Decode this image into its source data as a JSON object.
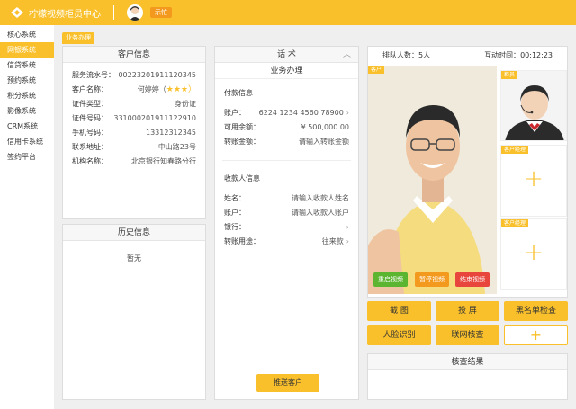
{
  "header": {
    "app_title": "柠檬视频柜员中心",
    "status": "示忙"
  },
  "sidebar": {
    "items": [
      {
        "label": "核心系统",
        "active": false
      },
      {
        "label": "网银系统",
        "active": true
      },
      {
        "label": "信贷系统",
        "active": false
      },
      {
        "label": "预约系统",
        "active": false
      },
      {
        "label": "积分系统",
        "active": false
      },
      {
        "label": "影像系统",
        "active": false
      },
      {
        "label": "CRM系统",
        "active": false
      },
      {
        "label": "信用卡系统",
        "active": false
      },
      {
        "label": "签约平台",
        "active": false
      }
    ]
  },
  "tab": {
    "label": "业务办理"
  },
  "customer": {
    "title": "客户信息",
    "rows": [
      {
        "k": "服务流水号：",
        "v": "00223201911120345"
      },
      {
        "k": "客户名称：",
        "v": "何婷婷（"
      },
      {
        "k": "证件类型：",
        "v": "身份证"
      },
      {
        "k": "证件号码：",
        "v": "331000201911122910"
      },
      {
        "k": "手机号码：",
        "v": "13312312345"
      },
      {
        "k": "联系地址：",
        "v": "中山路23号"
      },
      {
        "k": "机构名称：",
        "v": "北京银行知春路分行"
      }
    ],
    "stars": "★★★）"
  },
  "history": {
    "title": "历史信息",
    "empty": "暂无"
  },
  "script": {
    "title": "话 术",
    "subtitle": "业务办理"
  },
  "payment": {
    "title": "付款信息",
    "account_label": "账户：",
    "account_value": "6224 1234 4560 78900",
    "balance_label": "可用余额：",
    "balance_value": "¥ 500,000.00",
    "amount_label": "转账金额：",
    "amount_placeholder": "请输入转账金额"
  },
  "payee": {
    "title": "收款人信息",
    "name_label": "姓名：",
    "name_placeholder": "请输入收款人姓名",
    "account_label": "账户：",
    "account_placeholder": "请输入收款人账户",
    "bank_label": "银行：",
    "purpose_label": "转账用途：",
    "purpose_value": "往来款"
  },
  "push_button": "推送客户",
  "queue": {
    "count_label": "排队人数：",
    "count": "5人",
    "time_label": "互动时间：",
    "time": "00:12:23"
  },
  "video": {
    "customer_tag": "客户",
    "teller_tag": "柜员",
    "manager_tag": "客户经理",
    "restart": "重启视频",
    "pause": "暂停视频",
    "end": "结束视频"
  },
  "actions": [
    "截 图",
    "投 屏",
    "黑名单检查",
    "人脸识别",
    "联网核查",
    "+"
  ],
  "check_result": {
    "title": "核查结果"
  },
  "colors": {
    "accent": "#f9c02b",
    "green": "#5cb531",
    "orange": "#f39a1e",
    "red": "#e8463c"
  }
}
